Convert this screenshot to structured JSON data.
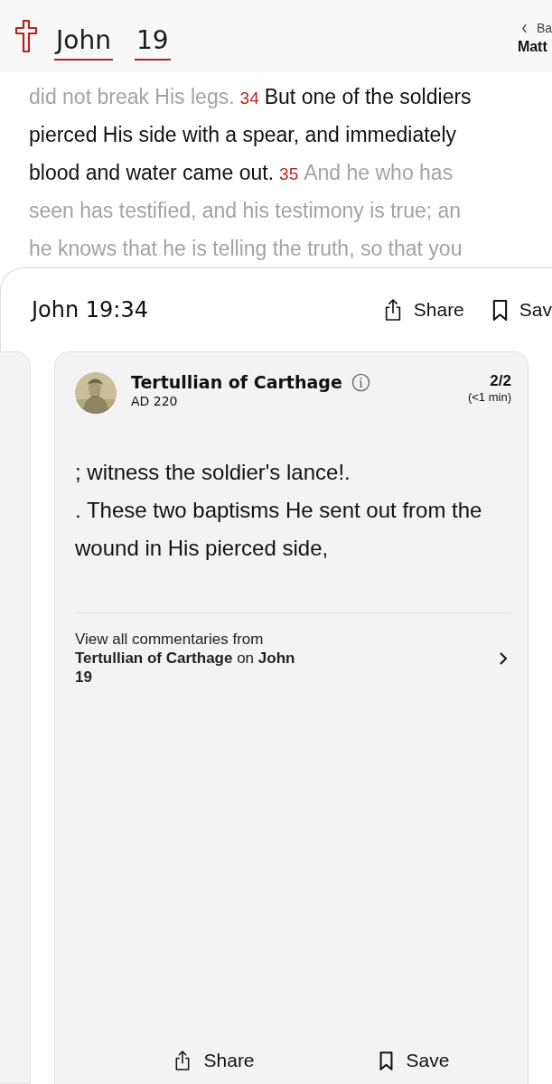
{
  "header": {
    "book": "John",
    "chapter": "19",
    "back_label": "Ba",
    "back_title": "Matt"
  },
  "passage_lines": [
    [
      {
        "kind": "faded",
        "text": "did not break His legs."
      },
      {
        "kind": "number",
        "text": "34"
      },
      {
        "kind": "highlight",
        "text": "But one of the soldiers"
      }
    ],
    [
      {
        "kind": "highlight",
        "text": "pierced His side with a spear, and immediately"
      }
    ],
    [
      {
        "kind": "highlight",
        "text": "blood and water came out."
      },
      {
        "kind": "number",
        "text": "35"
      },
      {
        "kind": "faded",
        "text": "And he who has"
      }
    ],
    [
      {
        "kind": "faded",
        "text": "seen has testified, and his testimony is true; an"
      }
    ],
    [
      {
        "kind": "faded",
        "text": "he knows that he is telling the truth, so that you"
      }
    ]
  ],
  "sheet": {
    "title": "John 19:34",
    "share": "Share",
    "save": "Sav",
    "card": {
      "author": "Tertullian of Carthage",
      "date": "AD 220",
      "page": "2/2",
      "read_time": "(<1 min)",
      "paragraphs": [
        "; witness the soldier's lance!.",
        ". These two baptisms He sent out from the wound in His pierced side,"
      ],
      "link": "View all commentaries from **Tertullian of Carthage** on **John 19**",
      "share": "Share",
      "save": "Save"
    }
  }
}
